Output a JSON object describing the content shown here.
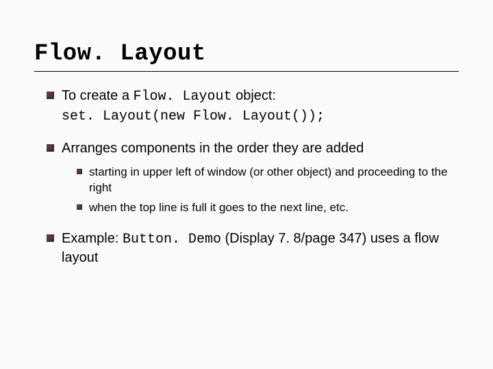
{
  "title": "Flow. Layout",
  "bullets": [
    {
      "pre": "To create a ",
      "code_inline": "Flow. Layout",
      "post": " object:",
      "codeline": "set. Layout(new Flow. Layout());"
    },
    {
      "text": "Arranges components in the order they are added",
      "sub": [
        "starting in upper left of window (or other object) and proceeding to the right",
        "when the top line is full it goes to the next line, etc."
      ]
    },
    {
      "pre": "Example: ",
      "code_inline": "Button. Demo",
      "post": " (Display 7. 8/page 347) uses a flow layout"
    }
  ]
}
